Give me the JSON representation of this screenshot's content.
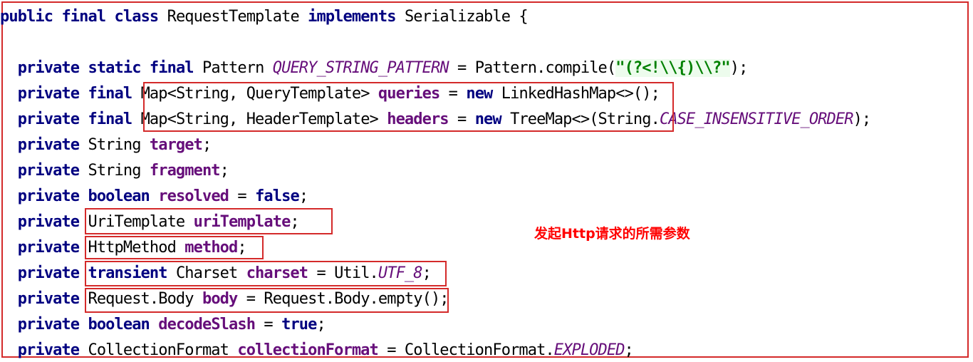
{
  "code_lines": [
    "public final class RequestTemplate implements Serializable {",
    "",
    "  private static final Pattern QUERY_STRING_PATTERN = Pattern.compile(\"(?<!\\\\{)\\\\?\");",
    "  private final Map<String, QueryTemplate> queries = new LinkedHashMap<>();",
    "  private final Map<String, HeaderTemplate> headers = new TreeMap<>(String.CASE_INSENSITIVE_ORDER);",
    "  private String target;",
    "  private String fragment;",
    "  private boolean resolved = false;",
    "  private UriTemplate uriTemplate;",
    "  private HttpMethod method;",
    "  private transient Charset charset = Util.UTF_8;",
    "  private Request.Body body = Request.Body.empty();",
    "  private boolean decodeSlash = true;",
    "  private CollectionFormat collectionFormat = CollectionFormat.EXPLODED;"
  ],
  "annotation": {
    "text": "发起Http请求的所需参数"
  },
  "colors": {
    "keyword": "#000080",
    "field": "#660e7a",
    "string": "#008000",
    "highlight_box": "#d42a2a",
    "annotation": "#ff0000"
  }
}
